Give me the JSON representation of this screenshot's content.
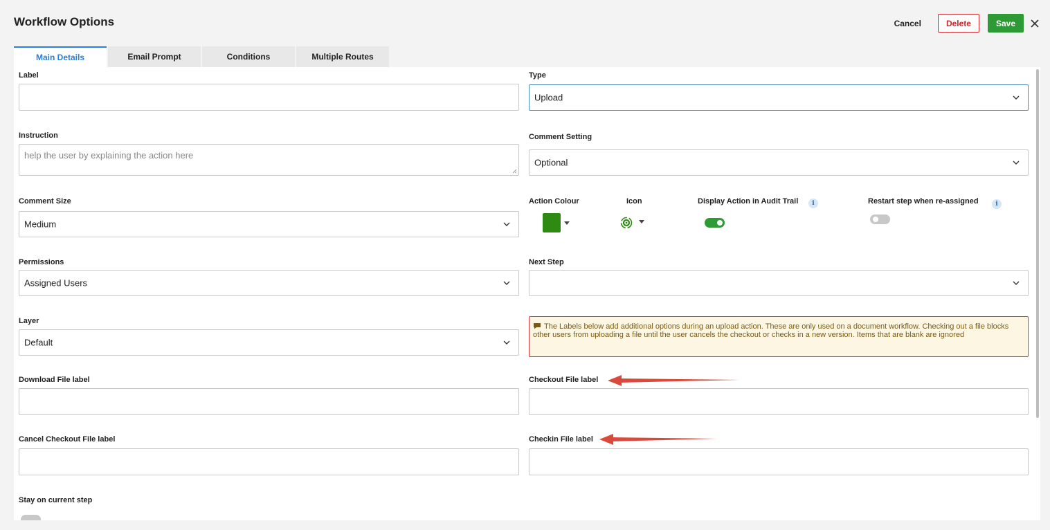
{
  "window": {
    "title": "Workflow Options"
  },
  "actions": {
    "cancel": "Cancel",
    "delete": "Delete",
    "save": "Save"
  },
  "tabs": [
    {
      "label": "Main Details",
      "active": true
    },
    {
      "label": "Email Prompt",
      "active": false
    },
    {
      "label": "Conditions",
      "active": false
    },
    {
      "label": "Multiple Routes",
      "active": false
    }
  ],
  "form": {
    "label": {
      "label": "Label",
      "value": ""
    },
    "type": {
      "label": "Type",
      "value": "Upload"
    },
    "instruction": {
      "label": "Instruction",
      "placeholder": "help the user by explaining the action here"
    },
    "comment_setting": {
      "label": "Comment Setting",
      "value": "Optional"
    },
    "comment_size": {
      "label": "Comment Size",
      "value": "Medium"
    },
    "action_colour": {
      "label": "Action Colour",
      "color": "#2e8a12"
    },
    "icon": {
      "label": "Icon",
      "icon_name": "gear-sync-icon"
    },
    "display_in_audit": {
      "label": "Display Action in Audit Trail",
      "on": true
    },
    "restart_step": {
      "label": "Restart step when re-assigned",
      "on": false
    },
    "permissions": {
      "label": "Permissions",
      "value": "Assigned Users"
    },
    "next_step": {
      "label": "Next Step",
      "value": ""
    },
    "layer": {
      "label": "Layer",
      "value": "Default"
    },
    "notice": "The Labels below add additional options during an upload action. These are only used on a document workflow. Checking out a file blocks other users from uploading a file until the user cancels the checkout or checks in a new version. Items that are blank are ignored",
    "download_label": {
      "label": "Download File label",
      "value": ""
    },
    "checkout_label": {
      "label": "Checkout File label",
      "value": ""
    },
    "cancel_checkout_label": {
      "label": "Cancel Checkout File label",
      "value": ""
    },
    "checkin_label": {
      "label": "Checkin File label",
      "value": ""
    },
    "stay_on_step": {
      "label": "Stay on current step",
      "on": false
    }
  },
  "colors": {
    "accent": "#2a7de1",
    "save": "#2e9a35",
    "delete": "#d0282c",
    "toggle_on": "#2e9a35",
    "toggle_off": "#c8c8c8",
    "annotation_arrow": "#d94a3c"
  }
}
